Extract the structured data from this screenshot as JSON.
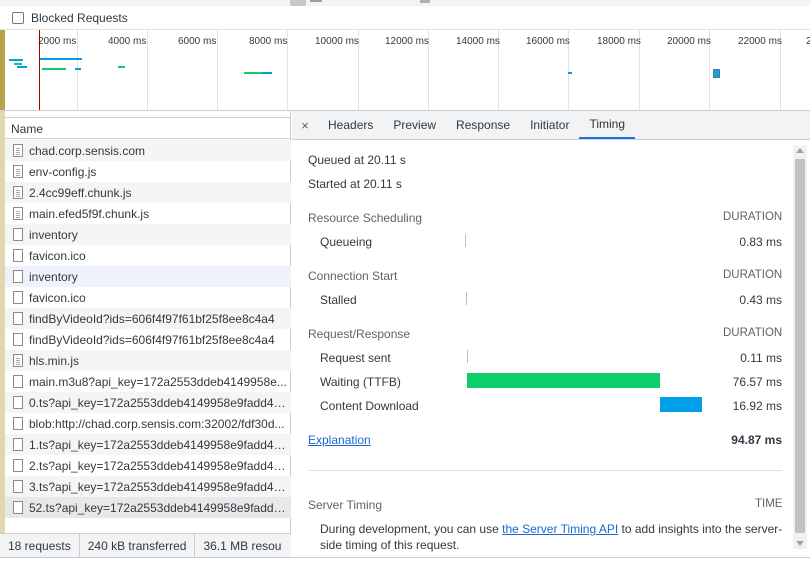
{
  "blocked_requests": {
    "label": "Blocked Requests",
    "checked": false
  },
  "overview": {
    "ticks": [
      "2000 ms",
      "4000 ms",
      "6000 ms",
      "8000 ms",
      "10000 ms",
      "12000 ms",
      "14000 ms",
      "16000 ms",
      "18000 ms",
      "20000 ms",
      "22000 ms",
      "2"
    ]
  },
  "request_list": {
    "column_header": "Name",
    "rows": [
      {
        "name": "chad.corp.sensis.com",
        "icon": "document-icon"
      },
      {
        "name": "env-config.js",
        "icon": "script-icon"
      },
      {
        "name": "2.4cc99eff.chunk.js",
        "icon": "script-icon"
      },
      {
        "name": "main.efed5f9f.chunk.js",
        "icon": "script-icon"
      },
      {
        "name": "inventory",
        "icon": "file-icon"
      },
      {
        "name": "favicon.ico",
        "icon": "file-icon"
      },
      {
        "name": "inventory",
        "icon": "file-icon"
      },
      {
        "name": "favicon.ico",
        "icon": "file-icon"
      },
      {
        "name": "findByVideoId?ids=606f4f97f61bf25f8ee8c4a4",
        "icon": "file-icon"
      },
      {
        "name": "findByVideoId?ids=606f4f97f61bf25f8ee8c4a4",
        "icon": "file-icon"
      },
      {
        "name": "hls.min.js",
        "icon": "script-icon"
      },
      {
        "name": "main.m3u8?api_key=172a2553ddeb4149958e...",
        "icon": "file-icon"
      },
      {
        "name": "0.ts?api_key=172a2553ddeb4149958e9fadd42...",
        "icon": "file-icon"
      },
      {
        "name": "blob:http://chad.corp.sensis.com:32002/fdf30d...",
        "icon": "file-icon"
      },
      {
        "name": "1.ts?api_key=172a2553ddeb4149958e9fadd42...",
        "icon": "file-icon"
      },
      {
        "name": "2.ts?api_key=172a2553ddeb4149958e9fadd42...",
        "icon": "file-icon"
      },
      {
        "name": "3.ts?api_key=172a2553ddeb4149958e9fadd42...",
        "icon": "file-icon"
      },
      {
        "name": "52.ts?api_key=172a2553ddeb4149958e9fadd4...",
        "icon": "file-icon"
      }
    ]
  },
  "status_bar": {
    "requests": "18 requests",
    "transferred": "240 kB transferred",
    "resources": "36.1 MB resou"
  },
  "tabs": {
    "close": "×",
    "items": [
      "Headers",
      "Preview",
      "Response",
      "Initiator",
      "Timing"
    ],
    "active": "Timing"
  },
  "timing": {
    "queued_at": "Queued at 20.11 s",
    "started_at": "Started at 20.11 s",
    "sections": {
      "resource_scheduling": {
        "title": "Resource Scheduling",
        "duration_label": "DURATION",
        "rows": [
          {
            "label": "Queueing",
            "value": "0.83 ms"
          }
        ]
      },
      "connection_start": {
        "title": "Connection Start",
        "duration_label": "DURATION",
        "rows": [
          {
            "label": "Stalled",
            "value": "0.43 ms"
          }
        ]
      },
      "request_response": {
        "title": "Request/Response",
        "duration_label": "DURATION",
        "rows": [
          {
            "label": "Request sent",
            "value": "0.11 ms"
          },
          {
            "label": "Waiting (TTFB)",
            "value": "76.57 ms",
            "color": "#0cce6b"
          },
          {
            "label": "Content Download",
            "value": "16.92 ms",
            "color": "#009fe8"
          }
        ]
      }
    },
    "explanation_link": "Explanation",
    "total": "94.87 ms",
    "server_timing": {
      "title": "Server Timing",
      "time_label": "TIME",
      "note_prefix": "During development, you can use ",
      "note_link": "the Server Timing API",
      "note_suffix_line1": " to add insights into the server-",
      "note_line2": "side timing of this request."
    }
  },
  "colors": {
    "accent": "#1a73e8",
    "waiting": "#0cce6b",
    "download": "#009fe8",
    "dom_content_line": "#a40000"
  }
}
